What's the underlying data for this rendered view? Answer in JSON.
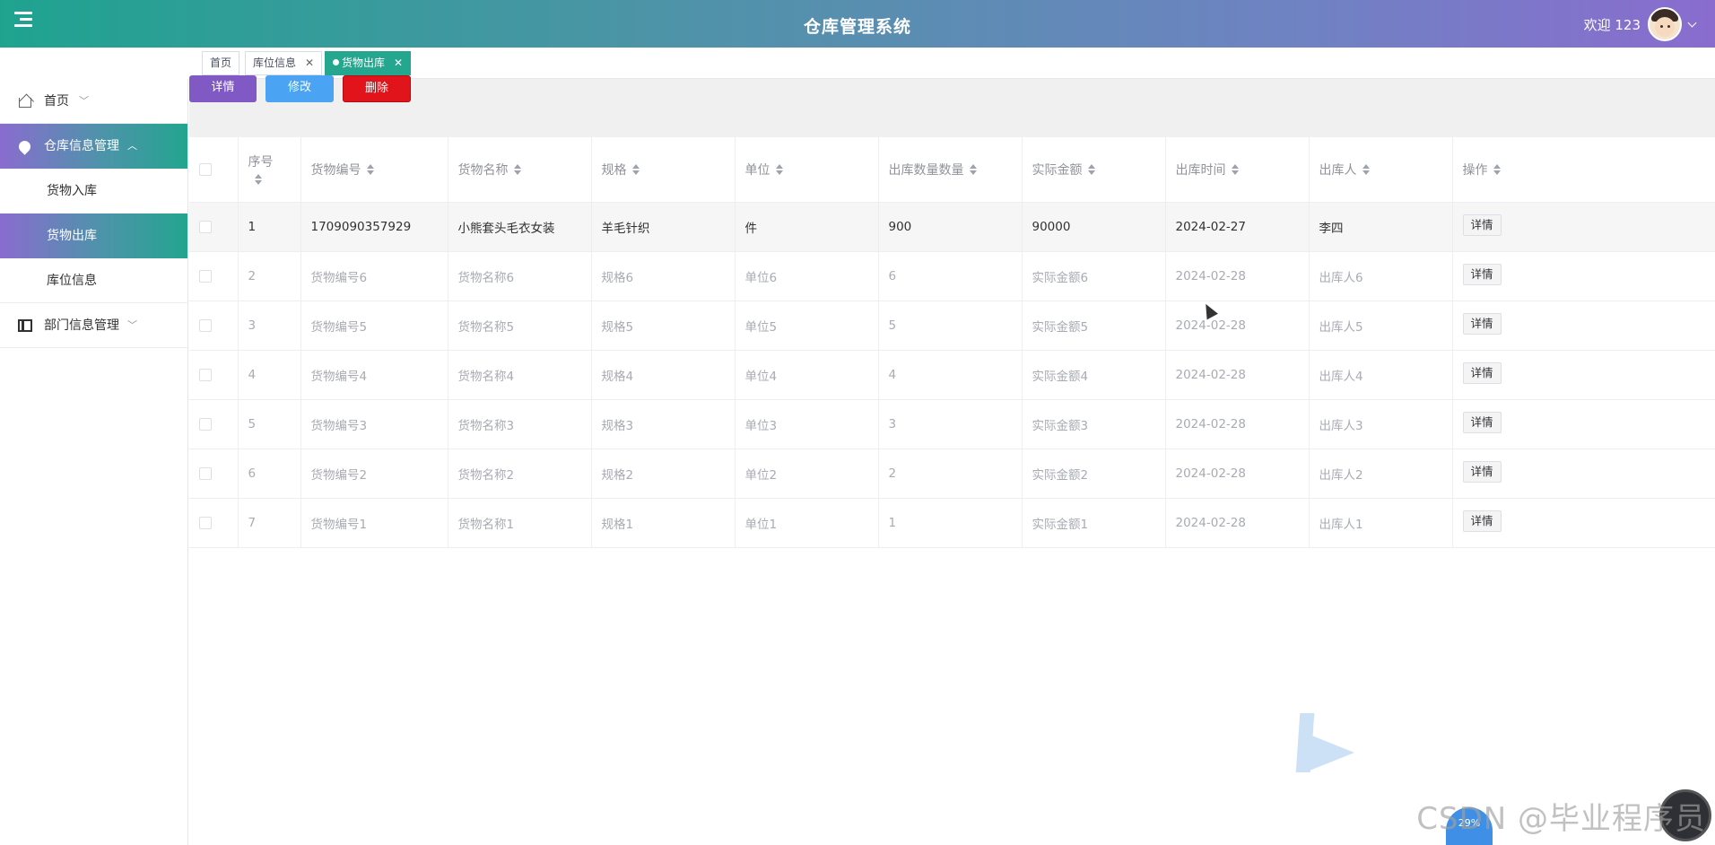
{
  "header": {
    "title": "仓库管理系统",
    "welcome": "欢迎 123"
  },
  "tabs": [
    {
      "label": "首页"
    },
    {
      "label": "库位信息"
    },
    {
      "label": "货物出库"
    }
  ],
  "sidebar": {
    "home": "首页",
    "warehouse_group": "仓库信息管理",
    "warehouse_items": [
      {
        "label": "货物入库"
      },
      {
        "label": "货物出库"
      },
      {
        "label": "库位信息"
      }
    ],
    "dept_group": "部门信息管理"
  },
  "actions": {
    "detail": "详情",
    "edit": "修改",
    "delete": "删除"
  },
  "table": {
    "columns": [
      "序号",
      "货物编号",
      "货物名称",
      "规格",
      "单位",
      "出库数量数量",
      "实际金额",
      "出库时间",
      "出库人",
      "操作"
    ],
    "rows": [
      {
        "seq": "1",
        "code": "1709090357929",
        "name": "小熊套头毛衣女装",
        "spec": "羊毛针织",
        "unit": "件",
        "qty": "900",
        "amount": "90000",
        "time": "2024-02-27",
        "person": "李四",
        "op": "详情"
      },
      {
        "seq": "2",
        "code": "货物编号6",
        "name": "货物名称6",
        "spec": "规格6",
        "unit": "单位6",
        "qty": "6",
        "amount": "实际金额6",
        "time": "2024-02-28",
        "person": "出库人6",
        "op": "详情"
      },
      {
        "seq": "3",
        "code": "货物编号5",
        "name": "货物名称5",
        "spec": "规格5",
        "unit": "单位5",
        "qty": "5",
        "amount": "实际金额5",
        "time": "2024-02-28",
        "person": "出库人5",
        "op": "详情"
      },
      {
        "seq": "4",
        "code": "货物编号4",
        "name": "货物名称4",
        "spec": "规格4",
        "unit": "单位4",
        "qty": "4",
        "amount": "实际金额4",
        "time": "2024-02-28",
        "person": "出库人4",
        "op": "详情"
      },
      {
        "seq": "5",
        "code": "货物编号3",
        "name": "货物名称3",
        "spec": "规格3",
        "unit": "单位3",
        "qty": "3",
        "amount": "实际金额3",
        "time": "2024-02-28",
        "person": "出库人3",
        "op": "详情"
      },
      {
        "seq": "6",
        "code": "货物编号2",
        "name": "货物名称2",
        "spec": "规格2",
        "unit": "单位2",
        "qty": "2",
        "amount": "实际金额2",
        "time": "2024-02-28",
        "person": "出库人2",
        "op": "详情"
      },
      {
        "seq": "7",
        "code": "货物编号1",
        "name": "货物名称1",
        "spec": "规格1",
        "unit": "单位1",
        "qty": "1",
        "amount": "实际金额1",
        "time": "2024-02-28",
        "person": "出库人1",
        "op": "详情"
      }
    ]
  },
  "watermark": {
    "text": "CSDN @毕业程序员",
    "badge": "29%"
  },
  "colors": {
    "accent_green": "#25a68f",
    "accent_purple": "#8a6ccf",
    "detail_button": "#8159c4",
    "edit_button": "#4aa4f3",
    "delete_button": "#e1141b"
  }
}
